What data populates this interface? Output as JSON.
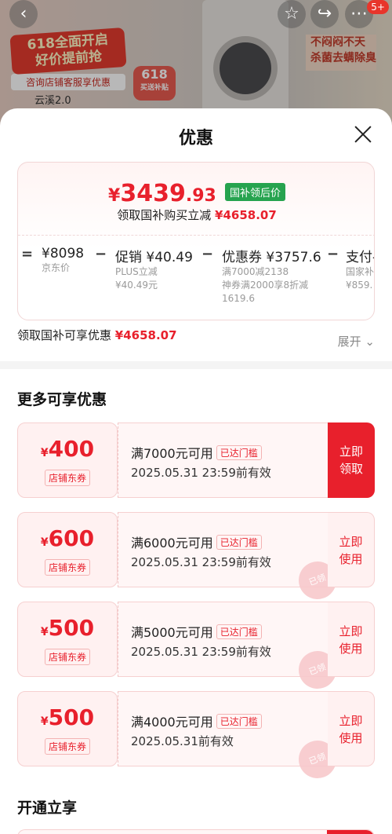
{
  "background": {
    "promo_title": "618全面开启",
    "promo_title2": "好价提前抢",
    "promo_sub": "咨询店铺客服享优惠",
    "promo_model": "云溪2.0",
    "badge_618": "618",
    "badge_618_sub": "买送补贴",
    "right_banner": "不闷闷不天 杀菌去螨除臭",
    "notification_count": "5+"
  },
  "sheet": {
    "title": "优惠",
    "final_price": {
      "currency": "¥",
      "integer": "3439",
      "decimal": ".93",
      "tag": "国补领后价"
    },
    "subsidy_line": {
      "label": "领取国补购买立减",
      "amount": "¥4658.07"
    },
    "formula": {
      "eq": "=",
      "terms": [
        {
          "op": "",
          "value": "¥8098",
          "sub1": "京东价",
          "sub2": "",
          "sub3": ""
        },
        {
          "op": "−",
          "value": "促销 ¥40.49",
          "sub1": "PLUS立减",
          "sub2": "¥40.49元",
          "sub3": ""
        },
        {
          "op": "−",
          "value": "优惠券 ¥3757.6",
          "sub1": "满7000减2138",
          "sub2": "神券满2000享8折减",
          "sub3": "1619.6"
        },
        {
          "op": "−",
          "value": "支付-",
          "sub1": "国家补",
          "sub2": "¥859.",
          "sub3": ""
        }
      ]
    },
    "gov_row": {
      "label": "领取国补可享优惠",
      "amount": "¥4658.07"
    },
    "expand_label": "展开",
    "section_more": "更多可享优惠",
    "coupons": [
      {
        "currency": "¥",
        "amount": "400",
        "type": "店铺东券",
        "condition": "满7000元可用",
        "reach": "已达门槛",
        "expiry": "2025.05.31 23:59前有效",
        "btn1": "立即",
        "btn2": "领取",
        "stamp": ""
      },
      {
        "currency": "¥",
        "amount": "600",
        "type": "店铺东券",
        "condition": "满6000元可用",
        "reach": "已达门槛",
        "expiry": "2025.05.31 23:59前有效",
        "btn1": "立即",
        "btn2": "使用",
        "stamp": "已领"
      },
      {
        "currency": "¥",
        "amount": "500",
        "type": "店铺东券",
        "condition": "满5000元可用",
        "reach": "已达门槛",
        "expiry": "2025.05.31 23:59前有效",
        "btn1": "立即",
        "btn2": "使用",
        "stamp": "已领"
      },
      {
        "currency": "¥",
        "amount": "500",
        "type": "店铺东券",
        "condition": "满4000元可用",
        "reach": "已达门槛",
        "expiry": "2025.05.31前有效",
        "btn1": "立即",
        "btn2": "使用",
        "stamp": "已领"
      }
    ],
    "section_open": "开通立享"
  },
  "colors": {
    "accent": "#e8202c",
    "green_tag": "#26a34f"
  },
  "icons": [
    "back-arrow-icon",
    "star-icon",
    "share-icon",
    "more-icon",
    "close-icon",
    "chevron-down-icon"
  ]
}
